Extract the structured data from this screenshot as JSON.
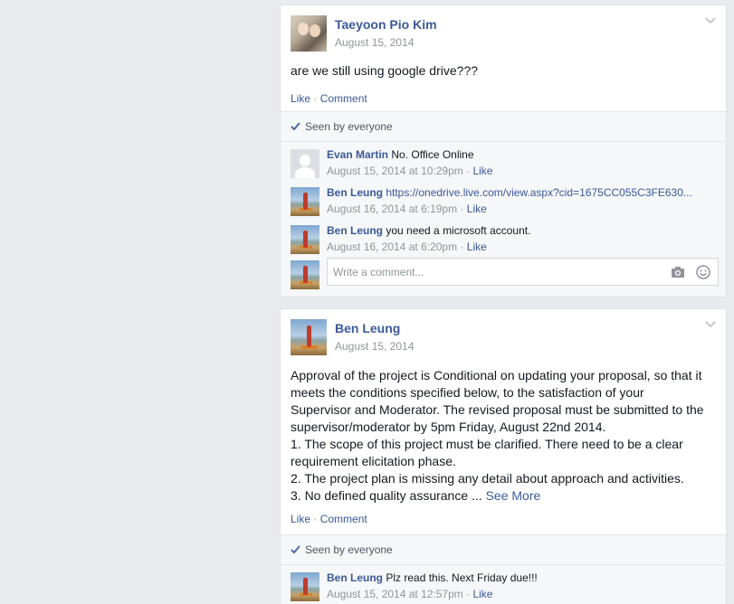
{
  "posts": [
    {
      "author": "Taeyoon Pio Kim",
      "date": "August 15, 2014",
      "body": "are we still using google drive???",
      "actions": {
        "like": "Like",
        "sep": "·",
        "comment": "Comment"
      },
      "seen": "Seen by everyone",
      "comments": [
        {
          "name": "Evan Martin",
          "text": "No. Office Online",
          "time": "August 15, 2014 at 10:29pm",
          "sep": "·",
          "like": "Like"
        },
        {
          "name": "Ben Leung",
          "text": "https://onedrive.live.com/view.aspx?cid=1675CC055C3FE630...",
          "time": "August 16, 2014 at 6:19pm",
          "sep": "·",
          "like": "Like"
        },
        {
          "name": "Ben Leung",
          "text": "you need a microsoft account.",
          "time": "August 16, 2014 at 6:20pm",
          "sep": "·",
          "like": "Like"
        }
      ],
      "write_placeholder": "Write a comment..."
    },
    {
      "author": "Ben Leung",
      "date": "August 15, 2014",
      "body_lines": [
        "Approval of the project is Conditional on updating your proposal, so that it",
        "meets the conditions specified below, to the satisfaction of your",
        "Supervisor and Moderator. The revised proposal must be submitted to the",
        "supervisor/moderator by 5pm Friday, August 22nd 2014.",
        "1. The scope of this project must be clarified. There need to be a clear",
        "requirement elicitation phase.",
        "2. The project plan is missing any detail about approach and activities.",
        "3. No defined quality assurance ..."
      ],
      "see_more": "See More",
      "actions": {
        "like": "Like",
        "sep": "·",
        "comment": "Comment"
      },
      "seen": "Seen by everyone",
      "comments": [
        {
          "name": "Ben Leung",
          "text": "Plz read this. Next Friday due!!!",
          "time": "August 15, 2014 at 12:57pm",
          "sep": "·",
          "like": "Like"
        }
      ]
    }
  ],
  "colors": {
    "link": "#3b5998",
    "meta": "#90949c",
    "background": "#e9eaed"
  },
  "icons": [
    "chevron-down-icon",
    "checkmark-icon",
    "camera-icon",
    "smiley-icon"
  ]
}
